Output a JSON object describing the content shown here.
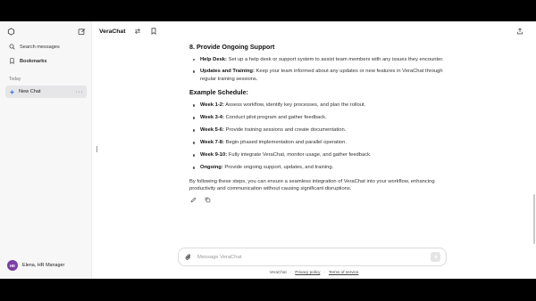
{
  "app": {
    "title": "VeraChat"
  },
  "sidebar": {
    "search_label": "Search messages",
    "bookmarks_label": "Bookmarks",
    "section_today": "Today",
    "chats": [
      {
        "label": "New Chat"
      }
    ],
    "user": {
      "initials": "HE",
      "name": "Elena, HR Manager"
    }
  },
  "content": {
    "support_heading": "8. Provide Ongoing Support",
    "support_items": [
      {
        "term": "Help Desk:",
        "text": " Set up a help desk or support system to assist team members with any issues they encounter."
      },
      {
        "term": "Updates and Training:",
        "text": " Keep your team informed about any updates or new features in VeraChat through regular training sessions."
      }
    ],
    "schedule_heading": "Example Schedule:",
    "schedule_items": [
      {
        "term": "Week 1-2:",
        "text": " Assess workflow, identify key processes, and plan the rollout."
      },
      {
        "term": "Week 3-4:",
        "text": " Conduct pilot program and gather feedback."
      },
      {
        "term": "Week 5-6:",
        "text": " Provide training sessions and create documentation."
      },
      {
        "term": "Week 7-8:",
        "text": " Begin phased implementation and parallel operation."
      },
      {
        "term": "Week 9-10:",
        "text": " Fully integrate VeraChat, monitor usage, and gather feedback."
      },
      {
        "term": "Ongoing:",
        "text": " Provide ongoing support, updates, and training."
      }
    ],
    "closing": "By following these steps, you can ensure a seamless integration of VeraChat into your workflow, enhancing productivity and communication without causing significant disruptions."
  },
  "composer": {
    "placeholder": "Message VeraChat"
  },
  "footer": {
    "brand": "VeraChat",
    "sep": "·",
    "privacy": "Privacy policy",
    "terms": "Terms of service"
  }
}
